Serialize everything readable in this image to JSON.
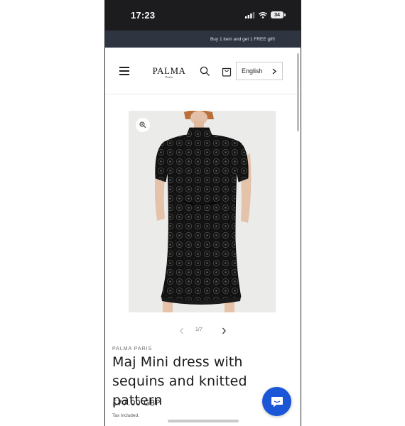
{
  "status_bar": {
    "time": "17:23",
    "battery": "34",
    "signal_icon": "cellular-signal-icon",
    "wifi_icon": "wifi-icon"
  },
  "announcement": {
    "text": "Buy 1 item and get 1 FREE gift!"
  },
  "header": {
    "menu_icon": "hamburger-menu-icon",
    "logo_main": "PALMA",
    "logo_sub": "Paris",
    "search_icon": "search-icon",
    "cart_icon": "shopping-bag-icon",
    "language": "English"
  },
  "gallery": {
    "current": "1/7",
    "zoom_icon": "zoom-in-icon"
  },
  "product": {
    "vendor": "PALMA PARIS",
    "title": "Maj Mini dress with sequins and knitted pattern",
    "price": "£77.00 GBP",
    "tax_note": "Tax included."
  },
  "chat": {
    "icon": "chat-bubble-icon"
  },
  "colors": {
    "status_bar_bg": "#1c1c1e",
    "announcement_bg": "#2e3440",
    "chat_button": "#1a56d6",
    "text": "#1a1a1a"
  }
}
